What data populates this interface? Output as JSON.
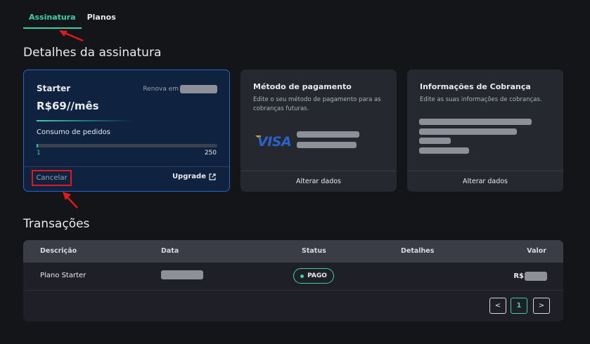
{
  "tabs": [
    {
      "label": "Assinatura",
      "active": true
    },
    {
      "label": "Planos",
      "active": false
    }
  ],
  "details_title": "Detalhes da assinatura",
  "plan": {
    "name": "Starter",
    "renew_label": "Renova em",
    "price": "R$69//mês",
    "usage_label": "Consumo de pedidos",
    "usage_min": "1",
    "usage_max": "250",
    "usage_fraction": 0.004,
    "cancel_label": "Cancelar",
    "upgrade_label": "Upgrade"
  },
  "payment": {
    "title": "Método de pagamento",
    "description": "Edite o seu método de pagamento para as cobranças futuras.",
    "brand": "VISA",
    "action": "Alterar dados"
  },
  "billing": {
    "title": "Informações de Cobrança",
    "description": "Edite as suas informações de cobranças.",
    "action": "Alterar dados"
  },
  "transactions": {
    "title": "Transações",
    "columns": [
      "Descrição",
      "Data",
      "Status",
      "Detalhes",
      "Valor"
    ],
    "rows": [
      {
        "description": "Plano Starter",
        "status": "PAGO",
        "value_prefix": "R$"
      }
    ],
    "pagination": {
      "prev": "<",
      "current": "1",
      "next": ">"
    }
  },
  "colors": {
    "accent": "#3ccfa8",
    "plan_border": "#2f63c0",
    "highlight_red": "#e01919"
  }
}
